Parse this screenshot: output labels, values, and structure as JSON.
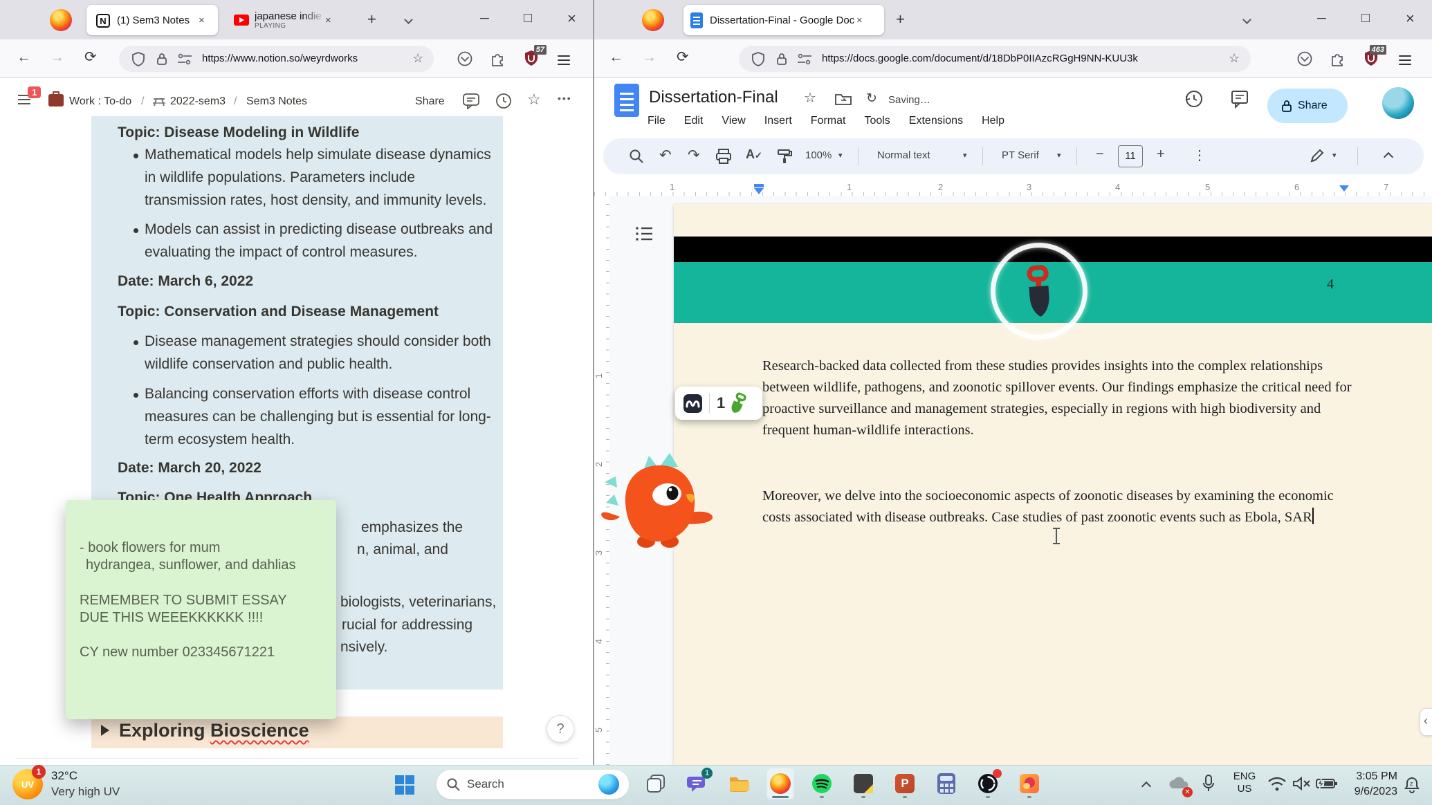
{
  "colors": {
    "teal_band": "#14b59a",
    "page_cream": "#faf3e1",
    "share_pill": "#c2e7ff",
    "notion_callout_blue": "#ddebf1",
    "notion_toggle_peach": "#f9e6d3",
    "sticky_green": "#daf3d1",
    "taskbar": "#d5e5e7",
    "badge_red": "#eb5757"
  },
  "left": {
    "tabs": {
      "t1": "(1) Sem3 Notes",
      "t2": "japanese indie r",
      "t2_sub": "PLAYING"
    },
    "url": "https://www.notion.so/weyrdworks",
    "ublock_badge": "57",
    "notion": {
      "sidebar_badge": "1",
      "crumb1": "Work : To-do",
      "sep1": "/",
      "crumb2": "2022-sem3",
      "sep2": "/",
      "crumb3": "Sem3 Notes",
      "share": "Share",
      "topic1": "Topic: Disease Modeling in Wildlife",
      "bullet1a": "Mathematical models help simulate disease dynamics in wildlife populations. Parameters include transmission rates, host density, and immunity levels.",
      "bullet1b": "Models can assist in predicting disease outbreaks and evaluating the impact of control measures.",
      "date1": "Date: March 6, 2022",
      "topic2": "Topic: Conservation and Disease Management",
      "bullet2a": "Disease management strategies should consider both wildlife conservation and public health.",
      "bullet2b": "Balancing conservation efforts with disease control measures can be challenging but is essential for long-term ecosystem health.",
      "date2": "Date: March 20, 2022",
      "topic3": "Topic: One Health Approach",
      "frag1": "emphasizes the",
      "frag2": "n, animal, and",
      "frag3": "biologists, veterinarians,",
      "frag4": "rucial for addressing",
      "frag5": "nsively.",
      "toggle_word1": "Exploring",
      "toggle_word2": "Bioscience",
      "help": "?"
    },
    "sticky": {
      "l1": "- book flowers for mum",
      "l2": "hydrangea, sunflower, and dahlias",
      "l3": "REMEMBER TO SUBMIT ESSAY DUE THIS WEEEKKKKKK !!!!",
      "l4": "CY new number 023345671221"
    }
  },
  "right": {
    "tab": "Dissertation-Final - Google Doc",
    "url": "https://docs.google.com/document/d/18DbP0IIAzcRGgH9NN-KUU3k",
    "ublock_badge": "463",
    "docs": {
      "title": "Dissertation-Final",
      "saving": "Saving…",
      "menus": [
        "File",
        "Edit",
        "View",
        "Insert",
        "Format",
        "Tools",
        "Extensions",
        "Help"
      ],
      "zoom": "100%",
      "style": "Normal text",
      "font": "PT Serif",
      "size": "11",
      "share": "Share",
      "page_num": "4",
      "p1": "Research-backed data collected from these studies provides insights into the complex relationships between wildlife, pathogens, and zoonotic spillover events. Our findings emphasize the critical need for proactive surveillance and management strategies, especially in regions with high biodiversity and frequent human-wildlife interactions.",
      "p2": "Moreover, we delve into the socioeconomic aspects of zoonotic diseases by examining the economic costs associated with disease outbreaks. Case studies of past zoonotic events such as Ebola, SAR",
      "hruler": [
        "1",
        "1",
        "2",
        "3",
        "4",
        "5",
        "6",
        "7"
      ],
      "vruler": [
        "1",
        "2",
        "3",
        "4",
        "5"
      ]
    },
    "pet_count": "1"
  },
  "taskbar": {
    "temp": "32°C",
    "uv_desc": "Very high UV",
    "uv_badge": "1",
    "uv_label": "UV",
    "search_placeholder": "Search",
    "chat_badge": "1",
    "lang_line1": "ENG",
    "lang_line2": "US",
    "time": "3:05 PM",
    "date": "9/6/2023"
  }
}
